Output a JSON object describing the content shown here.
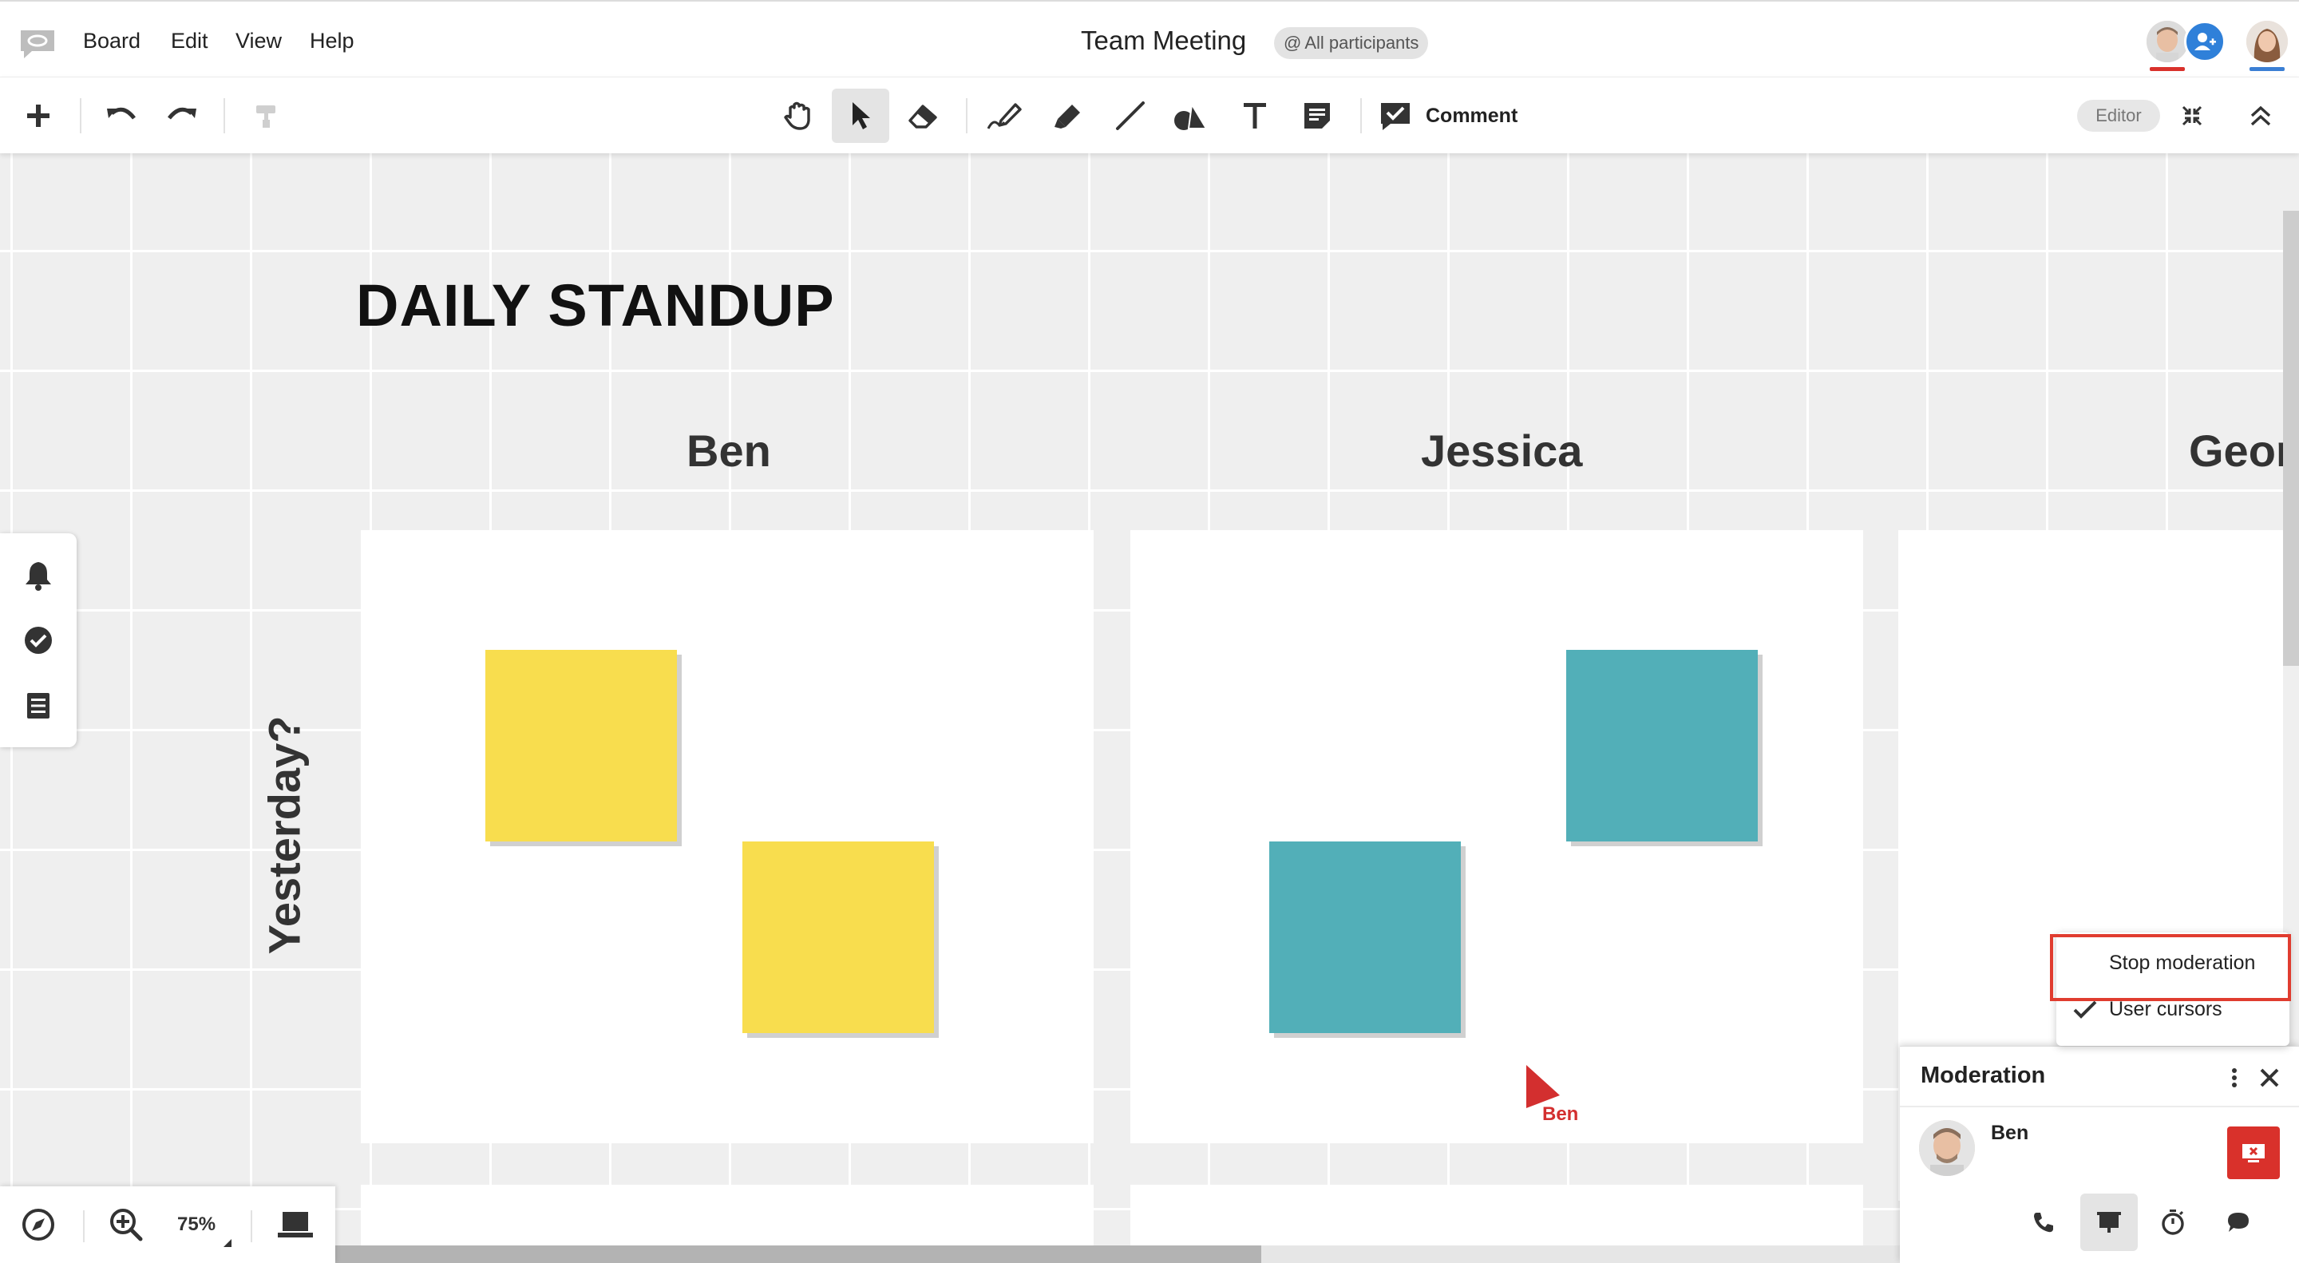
{
  "menubar": {
    "items": [
      "Board",
      "Edit",
      "View",
      "Help"
    ],
    "board_title": "Team Meeting",
    "participants_chip": "All participants",
    "at_symbol": "@"
  },
  "toolbar": {
    "tools": [
      "add-icon",
      "undo-icon",
      "redo-icon",
      "format-painter-icon",
      "hand-icon",
      "pointer-icon",
      "eraser-icon",
      "pen-icon",
      "highlighter-icon",
      "line-icon",
      "shapes-icon",
      "text-icon",
      "sticky-note-icon"
    ],
    "comment_label": "Comment",
    "editor_badge": "Editor"
  },
  "canvas": {
    "title": "DAILY STANDUP",
    "columns": [
      "Ben",
      "Jessica",
      "Geor"
    ],
    "row_label": "Yesterday?",
    "sticky_colors": {
      "yellow": "#f8dd4e",
      "teal": "#52afb8"
    },
    "remote_cursor_user": "Ben",
    "remote_cursor_color": "#d32f2f"
  },
  "side_panel": {
    "icons": [
      "bell-icon",
      "check-circle-icon",
      "list-icon"
    ]
  },
  "bottom_bar": {
    "zoom_level": "75%"
  },
  "context_menu": {
    "items": [
      {
        "label": "Stop moderation",
        "checked": false
      },
      {
        "label": "User cursors",
        "checked": true
      }
    ]
  },
  "moderation": {
    "title": "Moderation",
    "user_name": "Ben",
    "footer_icons": [
      "phone-icon",
      "presentation-icon",
      "timer-icon",
      "chat-icon"
    ]
  },
  "colors": {
    "accent_red": "#d9312b",
    "accent_blue": "#2f80d9"
  }
}
